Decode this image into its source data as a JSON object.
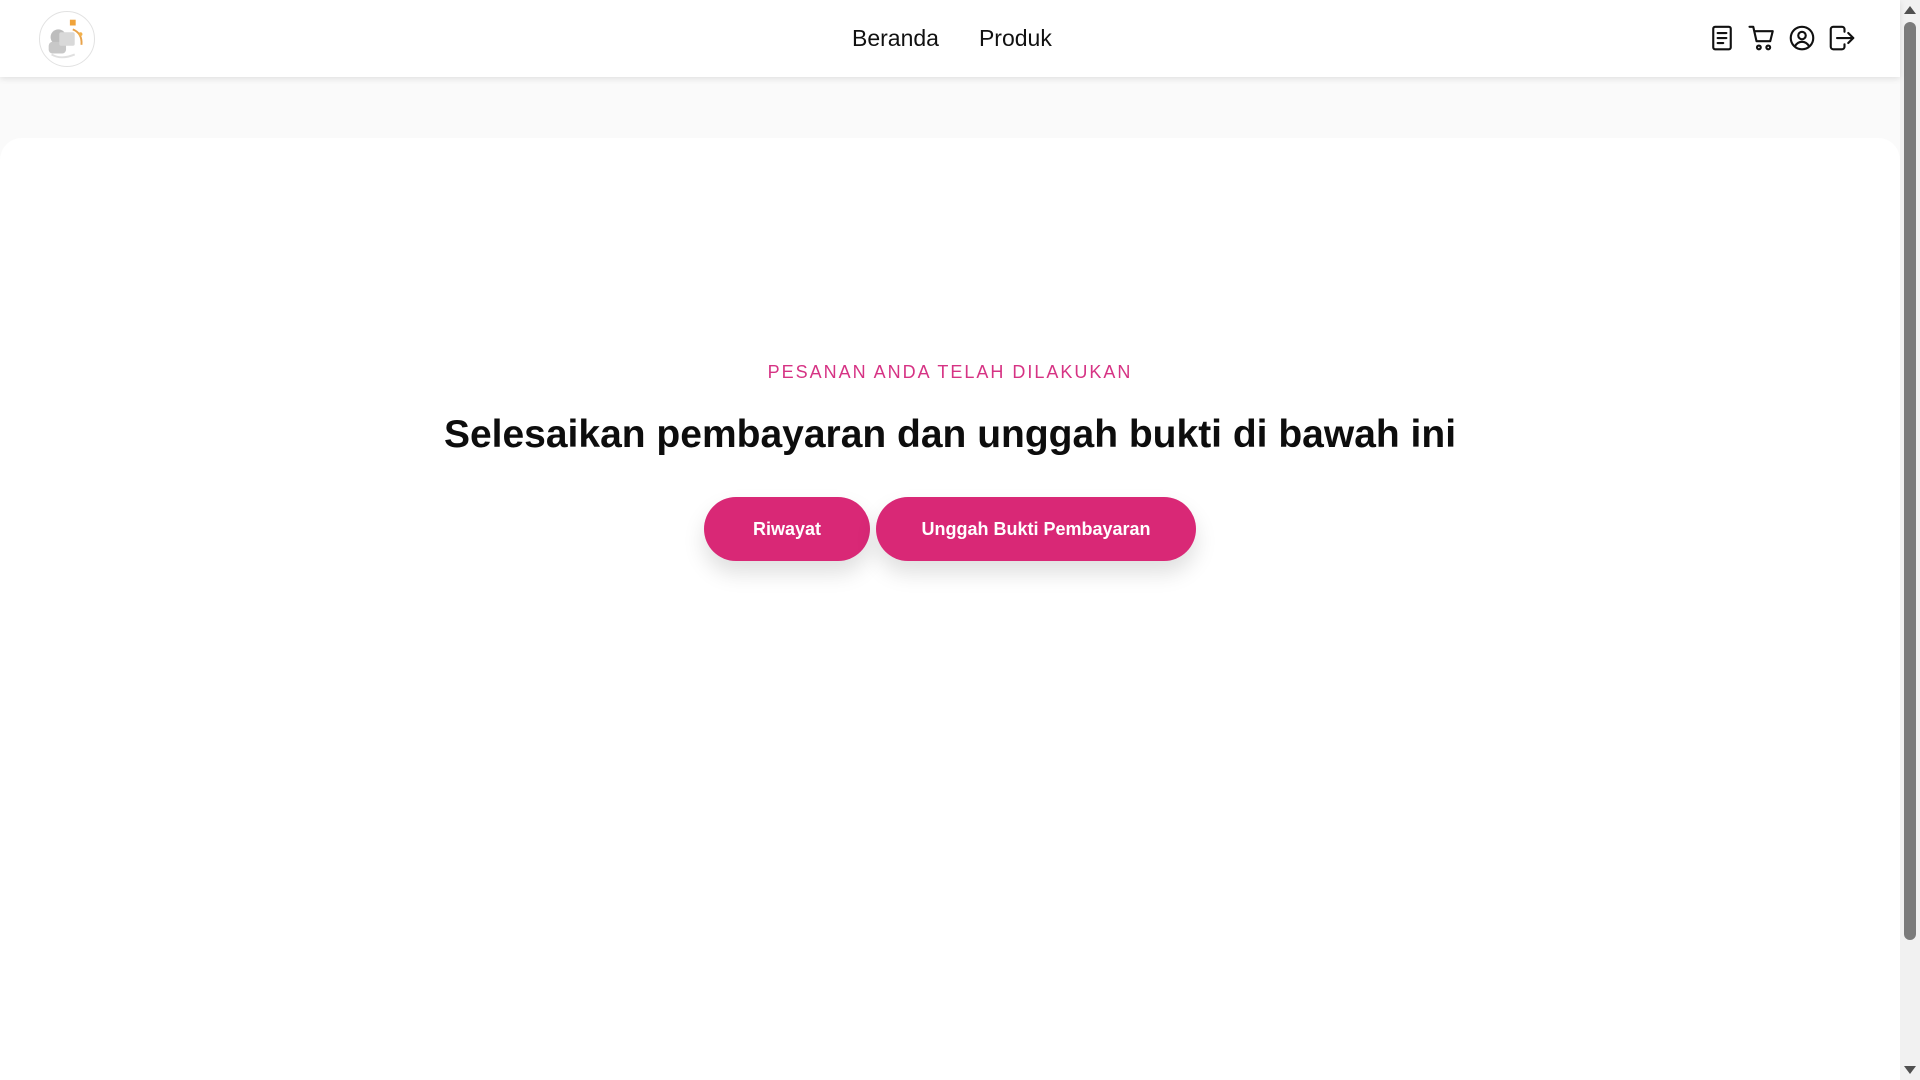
{
  "nav": {
    "links": [
      {
        "label": "Beranda"
      },
      {
        "label": "Produk"
      }
    ],
    "icons": [
      "orders-icon",
      "cart-icon",
      "user-account-icon",
      "logout-icon"
    ]
  },
  "main": {
    "subtitle": "PESANAN ANDA TELAH DILAKUKAN",
    "headline": "Selesaikan pembayaran dan unggah bukti di bawah ini",
    "buttons": {
      "history": "Riwayat",
      "upload": "Unggah Bukti Pembayaran"
    }
  },
  "colors": {
    "accent": "#d92876",
    "subtitle": "#d63384",
    "headline": "#0d0d0d"
  }
}
